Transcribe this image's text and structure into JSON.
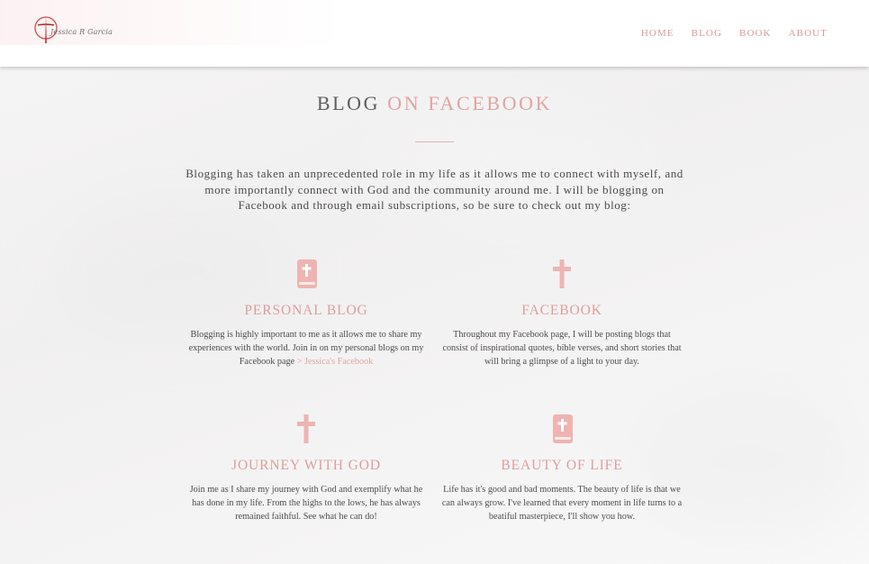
{
  "brand": {
    "signature": "Jessica R Garcia",
    "accent_color": "#de9e9c",
    "logo_icon": "cross-icon"
  },
  "nav": {
    "items": [
      {
        "label": "HOME"
      },
      {
        "label": "BLOG"
      },
      {
        "label": "BOOK"
      },
      {
        "label": "ABOUT"
      }
    ]
  },
  "main": {
    "title_plain": "BLOG",
    "title_accent": "ON FACEBOOK",
    "intro": "Blogging has taken an unprecedented role in my life as it allows me to connect with myself, and more importantly connect with God and the community around me. I will be blogging on Facebook and through email subscriptions, so be sure to check out my blog:"
  },
  "cards": [
    {
      "icon": "bible-icon",
      "heading": "PERSONAL BLOG",
      "body": "Blogging is highly important to me as it allows me to share my experiences with the world. Join in on my personal blogs on my Facebook page",
      "link": " > Jessica's Facebook"
    },
    {
      "icon": "cross-icon",
      "heading": "FACEBOOK",
      "body": "Throughout my Facebook page, I will be posting blogs that consist of inspirational quotes, bible verses, and short stories that will bring a glimpse of a light to your day."
    },
    {
      "icon": "cross-icon",
      "heading": "JOURNEY WITH GOD",
      "body": "Join me as I share my journey with God and exemplify what he has done in my life. From the highs to the lows, he has always remained faithful. See what he can do!"
    },
    {
      "icon": "bible-icon",
      "heading": "BEAUTY OF LIFE",
      "body": "Life has it's good and bad moments. The beauty of life is that we can always grow. I've learned that every moment in life turns to a beatiful masterpiece, I'll show you how."
    }
  ]
}
